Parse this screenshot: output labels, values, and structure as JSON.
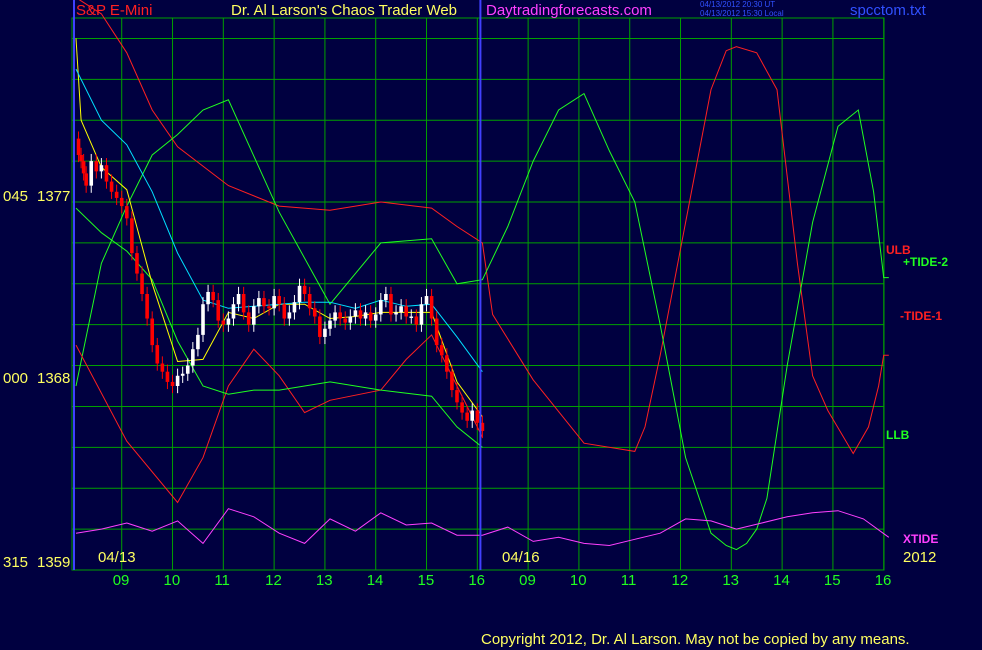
{
  "header": {
    "symbol": "S&P E-Mini",
    "title": "Dr. Al Larson's Chaos Trader Web",
    "site": "Daytradingforecasts.com",
    "time_line_1": "04/13/2012 20:30 UT",
    "time_line_2": "04/13/2012 15:30 Local",
    "file": "spcctom.txt"
  },
  "footer": {
    "copyright": "Copyright 2012, Dr. Al Larson. May not be copied by any means."
  },
  "colors": {
    "background": "#000040",
    "grid": "#00a000",
    "price_up": "#ffffff",
    "price_down": "#ff0000",
    "ulb": "#ff2020",
    "llb": "#20ff20",
    "tide1": "#ff2020",
    "tide2": "#20ff20",
    "xtide": "#ff40ff",
    "ma_fast": "#ffff00",
    "ma_slow": "#00e0ff",
    "date_marker": "#4040ff"
  },
  "chart_data": {
    "type": "line",
    "title": "S&P E-Mini",
    "xlabel": "",
    "ylabel": "",
    "ylim": [
      1359,
      1386
    ],
    "grid": true,
    "y_ticks": [
      {
        "prefix": "045",
        "value": 1377
      },
      {
        "prefix": "000",
        "value": 1368
      },
      {
        "prefix": "315",
        "value": 1359
      }
    ],
    "date_labels": [
      "04/13",
      "04/16"
    ],
    "year_label": "2012",
    "hours": [
      "09",
      "10",
      "11",
      "12",
      "13",
      "14",
      "15",
      "16",
      "09",
      "10",
      "11",
      "12",
      "13",
      "14",
      "15",
      "16"
    ],
    "series_labels": [
      {
        "name": "ULB",
        "y": 1373.6
      },
      {
        "name": "+TIDE-2",
        "y": 1372.8
      },
      {
        "name": "-TIDE-1",
        "y": 1369.5
      },
      {
        "name": "LLB",
        "y": 1364.6
      },
      {
        "name": "XTIDE",
        "y": 1359.8
      }
    ],
    "price": {
      "x": [
        0,
        0.05,
        0.1,
        0.15,
        0.2,
        0.3,
        0.4,
        0.5,
        0.6,
        0.7,
        0.8,
        0.9,
        1.0,
        1.1,
        1.2,
        1.3,
        1.4,
        1.5,
        1.6,
        1.7,
        1.8,
        1.9,
        2.0,
        2.1,
        2.2,
        2.3,
        2.4,
        2.5,
        2.6,
        2.7,
        2.8,
        2.9,
        3.0,
        3.1,
        3.2,
        3.3,
        3.4,
        3.5,
        3.6,
        3.7,
        3.8,
        3.9,
        4.0,
        4.1,
        4.2,
        4.3,
        4.4,
        4.5,
        4.6,
        4.7,
        4.8,
        4.9,
        5.0,
        5.1,
        5.2,
        5.3,
        5.4,
        5.5,
        5.6,
        5.7,
        5.8,
        5.9,
        6.0,
        6.1,
        6.2,
        6.3,
        6.4,
        6.5,
        6.6,
        6.7,
        6.8,
        6.9,
        7.0,
        7.1,
        7.2,
        7.3,
        7.4,
        7.5,
        7.6,
        7.7,
        7.8,
        7.9,
        8.0
      ],
      "y": [
        1380.1,
        1379.3,
        1379.0,
        1378.4,
        1377.8,
        1379.0,
        1378.5,
        1378.8,
        1378.0,
        1377.5,
        1377.2,
        1376.8,
        1376.2,
        1374.5,
        1373.5,
        1372.5,
        1371.3,
        1370.0,
        1369.1,
        1368.7,
        1368.2,
        1368.0,
        1368.5,
        1368.6,
        1369.0,
        1369.8,
        1370.5,
        1372.0,
        1372.6,
        1372.2,
        1371.2,
        1371.0,
        1371.3,
        1372.0,
        1372.5,
        1371.6,
        1371.0,
        1371.9,
        1372.3,
        1371.9,
        1371.8,
        1372.4,
        1372.0,
        1371.3,
        1371.6,
        1372.1,
        1372.9,
        1372.5,
        1371.8,
        1371.4,
        1370.4,
        1370.8,
        1371.2,
        1371.6,
        1371.3,
        1371.1,
        1371.4,
        1371.7,
        1371.3,
        1371.6,
        1371.2,
        1371.5,
        1372.2,
        1372.5,
        1371.5,
        1371.6,
        1371.9,
        1371.4,
        1371.4,
        1371.0,
        1372.0,
        1372.4,
        1371.3,
        1370.0,
        1369.5,
        1368.7,
        1367.8,
        1367.2,
        1366.7,
        1366.3,
        1366.8,
        1366.2,
        1365.8
      ]
    },
    "series": [
      {
        "name": "ULB",
        "x": [
          0,
          0.5,
          1,
          1.5,
          2,
          3,
          4,
          5,
          6,
          7,
          7.5,
          8,
          8.2,
          9,
          10,
          11,
          11.2,
          11.5,
          12,
          12.5,
          12.8,
          13.0,
          13.4,
          13.8,
          14.2,
          14.5,
          14.8,
          15.3,
          15.6,
          15.8,
          15.9,
          16.0
        ],
        "y": [
          1387,
          1386.2,
          1384.3,
          1381.5,
          1379.7,
          1377.8,
          1376.8,
          1376.6,
          1377.0,
          1376.7,
          1375.8,
          1375.0,
          1371.5,
          1368.3,
          1365.2,
          1364.8,
          1366.0,
          1369.5,
          1376.0,
          1382.5,
          1384.4,
          1384.6,
          1384.3,
          1382.5,
          1374.0,
          1368.5,
          1366.8,
          1364.7,
          1366.0,
          1368.0,
          1369.5,
          1369.5
        ]
      },
      {
        "name": "LLB",
        "x": [
          0,
          0.5,
          1,
          1.5,
          2,
          2.5,
          3,
          4,
          5,
          6,
          7,
          7.5,
          8,
          8.5,
          9,
          9.5,
          10,
          10.5,
          11,
          11.5,
          12,
          12.5,
          12.8,
          13.0,
          13.2,
          13.4,
          13.6,
          14,
          14.5,
          15,
          15.4,
          15.7,
          15.9,
          16.0
        ],
        "y": [
          1368.0,
          1374.0,
          1376.8,
          1379.3,
          1380.3,
          1381.5,
          1382.0,
          1376.5,
          1372.0,
          1375.0,
          1375.2,
          1373.0,
          1373.2,
          1375.8,
          1379.0,
          1381.5,
          1382.3,
          1379.5,
          1377.0,
          1371.0,
          1364.5,
          1360.8,
          1360.2,
          1360.0,
          1360.3,
          1361.0,
          1362.5,
          1369.0,
          1376.0,
          1380.7,
          1381.5,
          1377.5,
          1373.3,
          1373.3
        ]
      },
      {
        "name": "TIDE-1",
        "x": [
          0,
          1,
          2,
          2.5,
          3,
          3.5,
          4,
          4.5,
          5,
          6,
          6.5,
          7,
          7.5,
          8
        ],
        "y": [
          1370.0,
          1365.3,
          1362.3,
          1364.5,
          1368.0,
          1369.8,
          1368.5,
          1366.7,
          1367.3,
          1367.8,
          1369.3,
          1370.5,
          1368.0,
          1365.5
        ]
      },
      {
        "name": "TIDE-2",
        "x": [
          0,
          0.5,
          1,
          1.5,
          2,
          2.5,
          3,
          3.5,
          4,
          4.5,
          5,
          6,
          7,
          7.5,
          8
        ],
        "y": [
          1376.7,
          1375.5,
          1374.6,
          1373.2,
          1370.2,
          1368.0,
          1367.6,
          1367.8,
          1367.8,
          1368.0,
          1368.2,
          1367.8,
          1367.5,
          1366.0,
          1365.0
        ]
      },
      {
        "name": "XTIDE",
        "x": [
          0,
          0.5,
          1,
          1.5,
          2,
          2.5,
          3,
          3.5,
          4,
          4.5,
          5,
          5.5,
          6,
          6.5,
          7,
          7.5,
          8,
          8.5,
          9,
          9.5,
          10,
          10.5,
          11,
          11.5,
          12,
          12.5,
          13,
          13.5,
          14,
          14.5,
          15,
          15.5,
          16
        ],
        "y": [
          1360.8,
          1361.0,
          1361.3,
          1360.9,
          1361.4,
          1360.3,
          1362.0,
          1361.6,
          1360.8,
          1360.3,
          1361.5,
          1360.9,
          1361.8,
          1361.2,
          1361.3,
          1360.7,
          1360.7,
          1361.1,
          1360.4,
          1360.6,
          1360.3,
          1360.2,
          1360.5,
          1360.8,
          1361.5,
          1361.4,
          1361.0,
          1361.3,
          1361.6,
          1361.8,
          1361.9,
          1361.5,
          1360.6
        ]
      },
      {
        "name": "MA-fast",
        "x": [
          0,
          0.1,
          0.5,
          1,
          1.5,
          2,
          2.5,
          3,
          3.5,
          4,
          4.5,
          5,
          5.5,
          6,
          6.5,
          7,
          7.5,
          8
        ],
        "y": [
          1385.0,
          1381.0,
          1378.7,
          1377.6,
          1373.0,
          1369.2,
          1369.3,
          1371.6,
          1371.3,
          1372.0,
          1372.0,
          1371.3,
          1371.4,
          1371.6,
          1371.6,
          1371.6,
          1368.2,
          1366.5
        ]
      },
      {
        "name": "MA-slow",
        "x": [
          0,
          0.5,
          1,
          1.5,
          2,
          2.5,
          3,
          3.5,
          4,
          4.5,
          5,
          5.5,
          6,
          6.5,
          7,
          7.5,
          8
        ],
        "y": [
          1383.5,
          1381.0,
          1379.8,
          1377.5,
          1374.5,
          1372.2,
          1371.8,
          1371.9,
          1372.0,
          1372.1,
          1372.1,
          1371.8,
          1372.2,
          1371.9,
          1372.0,
          1370.4,
          1368.7
        ]
      }
    ]
  }
}
